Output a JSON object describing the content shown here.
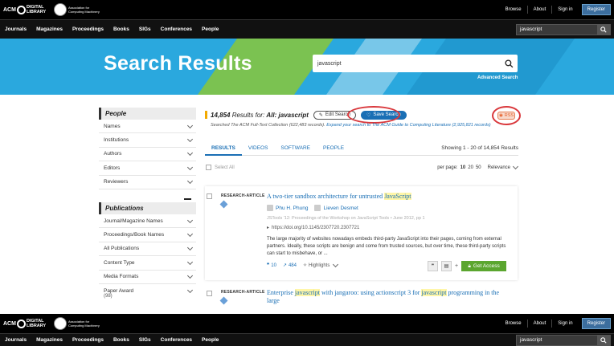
{
  "header": {
    "acm_text": "ACM",
    "dl_text": "DIGITAL LIBRARY",
    "assoc_text": "Association for Computing Machinery",
    "links": [
      "Browse",
      "About",
      "Sign in"
    ],
    "register": "Register"
  },
  "nav": {
    "items": [
      "Journals",
      "Magazines",
      "Proceedings",
      "Books",
      "SIGs",
      "Conferences",
      "People"
    ],
    "search_value": "javascript"
  },
  "banner": {
    "title": "Search Results",
    "search_value": "javascript",
    "advanced": "Advanced Search"
  },
  "sidebar": {
    "people_heading": "People",
    "people_items": [
      "Names",
      "Institutions",
      "Authors",
      "Editors",
      "Reviewers"
    ],
    "pub_heading": "Publications",
    "pub_items": [
      "Journal/Magazine Names",
      "Proceedings/Book Names",
      "All Publications",
      "Content Type",
      "Media Formats",
      "Paper Award"
    ],
    "paper_award_count": "(98)"
  },
  "results": {
    "count": "14,854",
    "results_for": "Results for:",
    "query": "All: javascript",
    "edit_search": "Edit Search",
    "save_search": "Save Search",
    "rss": "RSS",
    "searched_prefix": "Searched The ACM Full-Text Collection (622,483 records)",
    "searched_link": "Expand your search to The ACM Guide to Computing Literature (2,925,821 records)",
    "tabs": [
      "RESULTS",
      "VIDEOS",
      "SOFTWARE",
      "PEOPLE"
    ],
    "showing": "Showing 1 - 20 of 14,854 Results",
    "select_all": "Select All",
    "per_page_label": "per page:",
    "per_page_options": [
      "10",
      "20",
      "50"
    ],
    "sort": "Relevance"
  },
  "cards": [
    {
      "type": "RESEARCH-ARTICLE",
      "title_pre": "A two-tier sandbox architecture for untrusted ",
      "title_hl": "JavaScript",
      "authors": [
        "Phu H. Phung",
        "Lieven Desmet"
      ],
      "pub": "JSTools '12: Proceedings of the Workshop on JavaScript Tools • June 2012, pp 1",
      "doi": "https://doi.org/10.1145/2307720.2307721",
      "abstract": "The large majority of websites nowadays embeds third-party JavaScript into their pages, coming from external partners. Ideally, these scripts are benign and come from trusted sources, but over time, these third-party scripts can start to misbehave, or ...",
      "citations": "10",
      "downloads": "484",
      "highlights": "Highlights",
      "access": "Get Access"
    },
    {
      "type": "RESEARCH-ARTICLE",
      "title_pre": "Enterprise ",
      "title_hl": "javascript",
      "title_mid": " with jangaroo: using actionscript 3 for ",
      "title_hl2": "javascript",
      "title_post": " programming in the large"
    }
  ],
  "colors": {
    "banner_blue": "#2aa8de",
    "banner_green": "#84c441",
    "link_blue": "#1a6fb5",
    "access_green": "#5ba62f",
    "highlight_ring": "#d9373b"
  }
}
